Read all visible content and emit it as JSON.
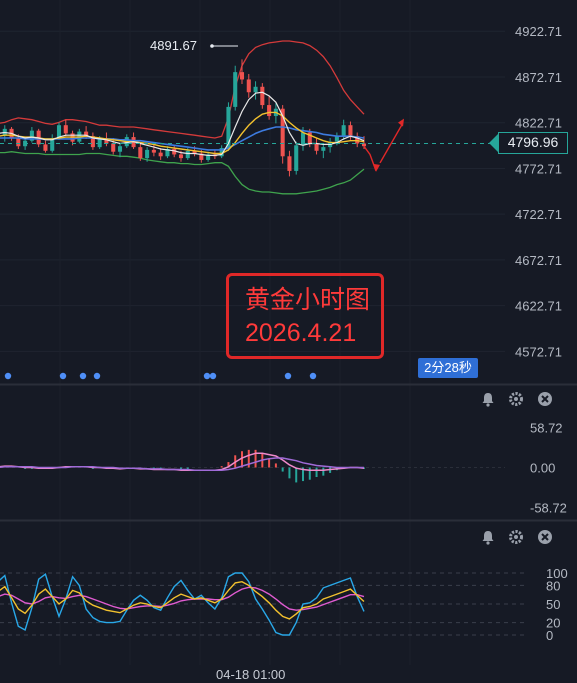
{
  "chart_data": [
    {
      "type": "candlestick",
      "title": "黄金小时图",
      "ylim": [
        4560,
        4935
      ],
      "y_ticks": [
        "4922.71",
        "4872.71",
        "4822.71",
        "4772.71",
        "4722.71",
        "4672.71",
        "4622.71",
        "4572.71"
      ],
      "last_price": "4796.96",
      "peak_label": "4891.67",
      "x_tick": "04-18 01:00",
      "countdown": "2分28秒",
      "note_lines": [
        "黄金小时图",
        "2026.4.21"
      ],
      "candles": [
        [
          4812,
          4815,
          4800,
          4809
        ],
        [
          4809,
          4820,
          4802,
          4816
        ],
        [
          4816,
          4818,
          4803,
          4806
        ],
        [
          4806,
          4810,
          4794,
          4797
        ],
        [
          4797,
          4806,
          4793,
          4803
        ],
        [
          4803,
          4818,
          4801,
          4814
        ],
        [
          4814,
          4816,
          4796,
          4799
        ],
        [
          4799,
          4803,
          4790,
          4792
        ],
        [
          4792,
          4810,
          4790,
          4806
        ],
        [
          4806,
          4823,
          4804,
          4820
        ],
        [
          4820,
          4826,
          4808,
          4811
        ],
        [
          4811,
          4814,
          4798,
          4802
        ],
        [
          4802,
          4816,
          4800,
          4813
        ],
        [
          4813,
          4819,
          4805,
          4808
        ],
        [
          4808,
          4812,
          4793,
          4796
        ],
        [
          4796,
          4808,
          4794,
          4805
        ],
        [
          4805,
          4812,
          4797,
          4800
        ],
        [
          4800,
          4806,
          4788,
          4791
        ],
        [
          4791,
          4800,
          4785,
          4797
        ],
        [
          4797,
          4810,
          4795,
          4807
        ],
        [
          4807,
          4812,
          4794,
          4796
        ],
        [
          4796,
          4800,
          4781,
          4784
        ],
        [
          4784,
          4796,
          4780,
          4793
        ],
        [
          4793,
          4800,
          4786,
          4790
        ],
        [
          4790,
          4795,
          4782,
          4786
        ],
        [
          4786,
          4797,
          4784,
          4794
        ],
        [
          4794,
          4798,
          4785,
          4788
        ],
        [
          4788,
          4792,
          4780,
          4784
        ],
        [
          4784,
          4795,
          4782,
          4792
        ],
        [
          4792,
          4797,
          4786,
          4789
        ],
        [
          4789,
          4793,
          4779,
          4782
        ],
        [
          4782,
          4791,
          4780,
          4788
        ],
        [
          4788,
          4793,
          4783,
          4786
        ],
        [
          4786,
          4798,
          4784,
          4795
        ],
        [
          4795,
          4845,
          4792,
          4840
        ],
        [
          4840,
          4885,
          4836,
          4878
        ],
        [
          4878,
          4892,
          4865,
          4870
        ],
        [
          4870,
          4876,
          4850,
          4856
        ],
        [
          4856,
          4868,
          4848,
          4862
        ],
        [
          4862,
          4866,
          4838,
          4842
        ],
        [
          4842,
          4852,
          4826,
          4830
        ],
        [
          4830,
          4844,
          4822,
          4838
        ],
        [
          4838,
          4842,
          4778,
          4786
        ],
        [
          4786,
          4792,
          4764,
          4770
        ],
        [
          4770,
          4802,
          4766,
          4798
        ],
        [
          4798,
          4818,
          4792,
          4812
        ],
        [
          4812,
          4816,
          4796,
          4800
        ],
        [
          4800,
          4806,
          4788,
          4792
        ],
        [
          4792,
          4800,
          4784,
          4796
        ],
        [
          4796,
          4806,
          4790,
          4802
        ],
        [
          4802,
          4812,
          4798,
          4808
        ],
        [
          4808,
          4826,
          4804,
          4820
        ],
        [
          4820,
          4824,
          4804,
          4808
        ],
        [
          4808,
          4812,
          4796,
          4800
        ],
        [
          4800,
          4808,
          4794,
          4797
        ]
      ],
      "ma_fast": [
        4811,
        4812,
        4811,
        4808,
        4806,
        4807,
        4806,
        4804,
        4804,
        4807,
        4809,
        4809,
        4809,
        4809,
        4806,
        4805,
        4804,
        4802,
        4800,
        4801,
        4802,
        4800,
        4798,
        4796,
        4794,
        4793,
        4792,
        4790,
        4789,
        4789,
        4788,
        4787,
        4787,
        4788,
        4800,
        4818,
        4835,
        4848,
        4855,
        4856,
        4852,
        4845,
        4830,
        4812,
        4800,
        4798,
        4800,
        4800,
        4799,
        4799,
        4801,
        4805,
        4808,
        4806,
        4803
      ],
      "ma_mid": [
        4808,
        4809,
        4809,
        4808,
        4807,
        4807,
        4806,
        4805,
        4805,
        4806,
        4807,
        4807,
        4807,
        4808,
        4807,
        4806,
        4805,
        4804,
        4803,
        4802,
        4802,
        4801,
        4800,
        4799,
        4797,
        4796,
        4795,
        4794,
        4793,
        4792,
        4791,
        4790,
        4789,
        4789,
        4793,
        4801,
        4811,
        4820,
        4827,
        4832,
        4834,
        4834,
        4830,
        4823,
        4817,
        4812,
        4809,
        4806,
        4803,
        4801,
        4801,
        4802,
        4803,
        4803,
        4802
      ],
      "ma_slow": [
        4806,
        4806,
        4806,
        4806,
        4805,
        4805,
        4805,
        4805,
        4805,
        4805,
        4805,
        4805,
        4806,
        4806,
        4806,
        4805,
        4805,
        4805,
        4804,
        4804,
        4803,
        4803,
        4802,
        4801,
        4800,
        4799,
        4798,
        4797,
        4796,
        4795,
        4794,
        4793,
        4793,
        4793,
        4795,
        4799,
        4803,
        4807,
        4811,
        4814,
        4816,
        4818,
        4818,
        4817,
        4815,
        4814,
        4813,
        4812,
        4810,
        4809,
        4808,
        4808,
        4808,
        4807,
        4806
      ],
      "bb_upper": [
        4822,
        4823,
        4826,
        4828,
        4827,
        4826,
        4824,
        4822,
        4821,
        4823,
        4826,
        4826,
        4825,
        4824,
        4822,
        4820,
        4820,
        4819,
        4818,
        4818,
        4818,
        4817,
        4816,
        4815,
        4814,
        4813,
        4812,
        4811,
        4810,
        4809,
        4808,
        4807,
        4806,
        4808,
        4828,
        4862,
        4885,
        4898,
        4905,
        4908,
        4910,
        4911,
        4912,
        4912,
        4911,
        4910,
        4907,
        4902,
        4895,
        4885,
        4872,
        4858,
        4848,
        4840,
        4832
      ],
      "bb_lower": [
        4790,
        4790,
        4791,
        4790,
        4789,
        4789,
        4789,
        4788,
        4788,
        4788,
        4788,
        4788,
        4788,
        4789,
        4789,
        4789,
        4788,
        4787,
        4786,
        4786,
        4785,
        4784,
        4782,
        4781,
        4780,
        4779,
        4779,
        4778,
        4778,
        4777,
        4777,
        4778,
        4779,
        4779,
        4775,
        4764,
        4755,
        4750,
        4748,
        4747,
        4747,
        4746,
        4745,
        4745,
        4745,
        4746,
        4747,
        4748,
        4750,
        4752,
        4755,
        4757,
        4760,
        4766,
        4772
      ],
      "projection": [
        4796.96,
        4788,
        4770,
        4810,
        4825
      ]
    },
    {
      "type": "macd",
      "ylim": [
        -70,
        70
      ],
      "y_ticks": [
        "58.72",
        "0.00",
        "-58.72"
      ],
      "macd": [
        1,
        2,
        2,
        1,
        0,
        0,
        -1,
        -1,
        -1,
        0,
        1,
        1,
        1,
        1,
        0,
        0,
        -1,
        -1,
        -2,
        -1,
        -1,
        -2,
        -2,
        -3,
        -3,
        -3,
        -3,
        -4,
        -4,
        -4,
        -4,
        -4,
        -4,
        -3,
        1,
        8,
        14,
        18,
        21,
        21,
        19,
        17,
        11,
        4,
        -1,
        -3,
        -4,
        -4,
        -4,
        -3,
        -2,
        -1,
        0,
        0,
        -1
      ],
      "signal": [
        0,
        1,
        1,
        1,
        1,
        1,
        0,
        0,
        0,
        0,
        0,
        1,
        1,
        1,
        1,
        0,
        0,
        0,
        -1,
        -1,
        -1,
        -1,
        -2,
        -2,
        -2,
        -3,
        -3,
        -3,
        -3,
        -4,
        -4,
        -4,
        -4,
        -4,
        -3,
        -1,
        2,
        5,
        8,
        11,
        13,
        14,
        14,
        12,
        10,
        7,
        5,
        3,
        2,
        1,
        0,
        0,
        0,
        0,
        0
      ]
    },
    {
      "type": "kdj",
      "ylim": [
        0,
        100
      ],
      "y_ticks": [
        "100",
        "80",
        "50",
        "20",
        "0"
      ],
      "k": [
        70,
        78,
        60,
        42,
        35,
        48,
        66,
        74,
        62,
        50,
        58,
        72,
        68,
        55,
        48,
        44,
        40,
        38,
        36,
        42,
        48,
        52,
        50,
        46,
        44,
        52,
        60,
        66,
        62,
        58,
        60,
        56,
        52,
        58,
        72,
        84,
        86,
        80,
        70,
        62,
        52,
        40,
        30,
        26,
        34,
        44,
        46,
        50,
        58,
        62,
        66,
        70,
        74,
        64,
        54
      ],
      "d": [
        62,
        66,
        64,
        58,
        52,
        50,
        54,
        60,
        62,
        60,
        59,
        62,
        64,
        62,
        58,
        54,
        50,
        46,
        43,
        42,
        44,
        46,
        47,
        47,
        46,
        48,
        51,
        55,
        57,
        58,
        58,
        58,
        57,
        57,
        61,
        68,
        74,
        77,
        76,
        72,
        66,
        58,
        49,
        42,
        40,
        41,
        43,
        45,
        49,
        53,
        57,
        61,
        65,
        65,
        62
      ],
      "j": [
        86,
        96,
        52,
        14,
        8,
        44,
        90,
        98,
        62,
        30,
        58,
        94,
        80,
        42,
        28,
        22,
        20,
        20,
        22,
        40,
        56,
        64,
        56,
        44,
        40,
        60,
        78,
        88,
        72,
        58,
        64,
        52,
        42,
        60,
        94,
        100,
        100,
        86,
        58,
        42,
        24,
        4,
        0,
        0,
        20,
        50,
        52,
        60,
        76,
        80,
        84,
        88,
        92,
        62,
        38
      ]
    }
  ]
}
